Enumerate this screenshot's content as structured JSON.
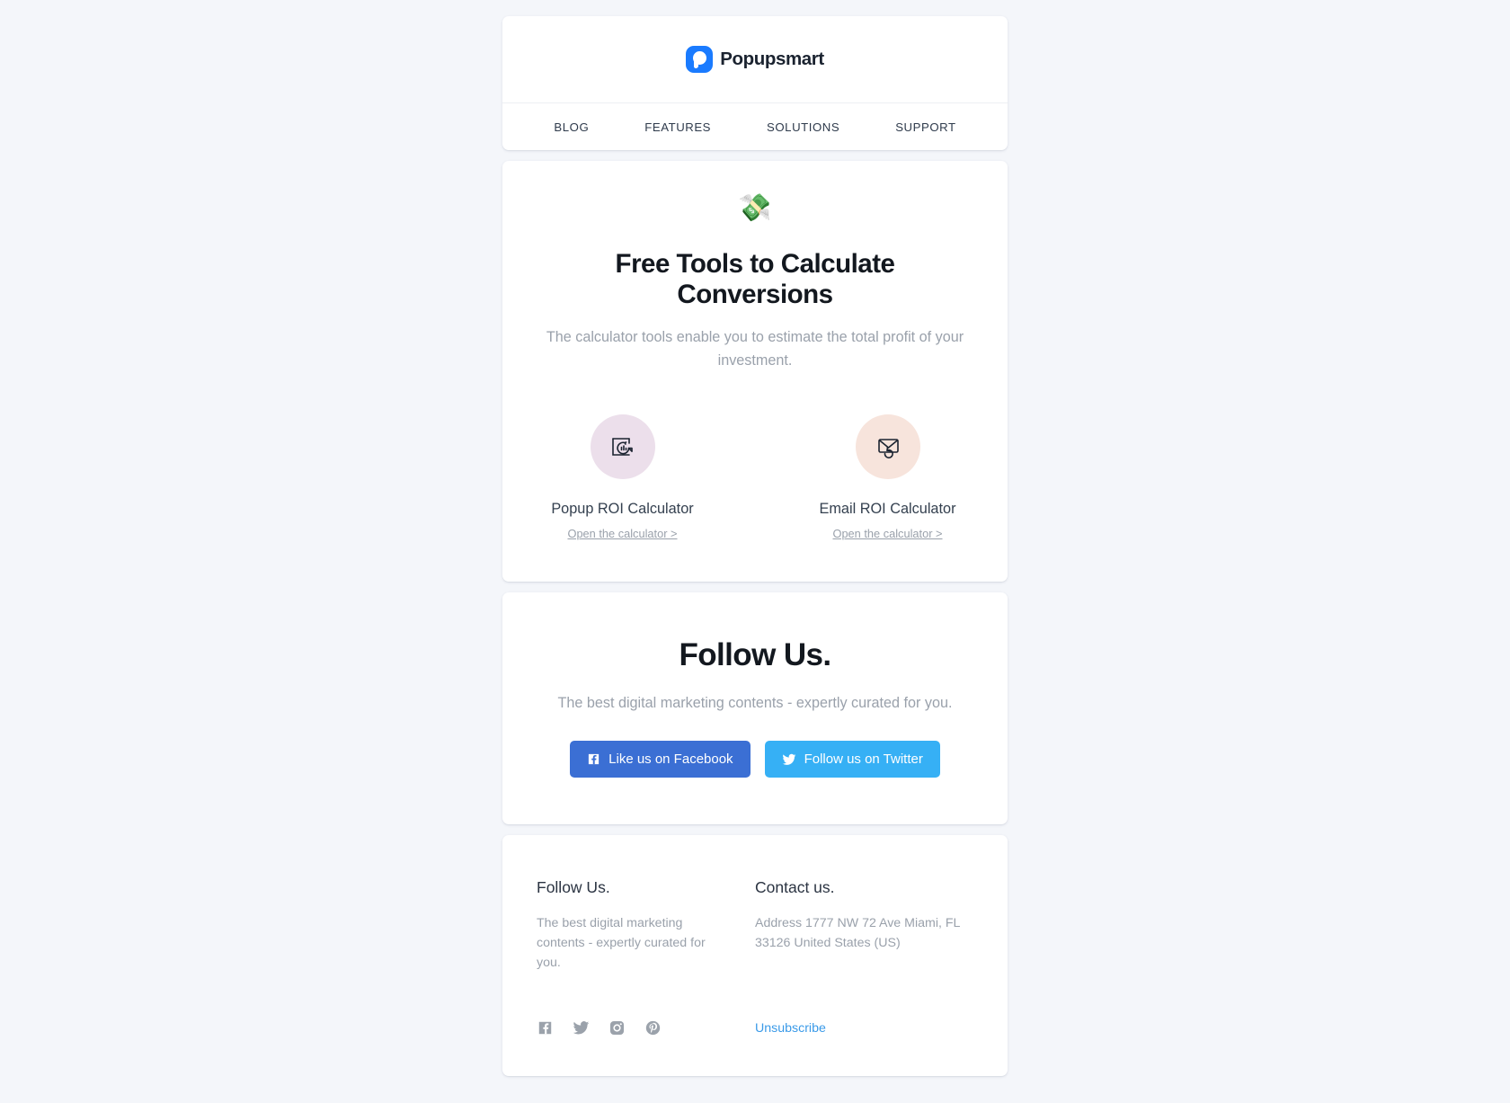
{
  "theme": {
    "page_background": "#f4f6fa",
    "card_background": "#ffffff",
    "brand_blue": "#1a7bff",
    "facebook_blue": "#3b6fd4",
    "twitter_blue": "#36b0f5",
    "link_blue": "#3a9ae8",
    "muted_text": "#9aa1ab",
    "heading_text": "#13181f",
    "popup_icon_bg": "#ecdfeb",
    "email_icon_bg": "#f7e4dc"
  },
  "header": {
    "logo_text": "Popupsmart",
    "logo_icon": "popupsmart-logo-icon",
    "nav": [
      {
        "label": "BLOG"
      },
      {
        "label": "FEATURES"
      },
      {
        "label": "SOLUTIONS"
      },
      {
        "label": "SUPPORT"
      }
    ]
  },
  "hero": {
    "emoji": "💸",
    "emoji_name": "money-with-wings-icon",
    "title": "Free Tools to Calculate Conversions",
    "subtitle": "The calculator tools enable you to estimate the total profit of your investment.",
    "tools": [
      {
        "name": "Popup ROI Calculator",
        "link_label": "Open the calculator >",
        "icon": "popup-roi-icon"
      },
      {
        "name": "Email ROI Calculator",
        "link_label": "Open the calculator >",
        "icon": "email-roi-icon"
      }
    ]
  },
  "follow": {
    "title": "Follow Us.",
    "subtitle": "The best digital marketing contents - expertly curated for you.",
    "buttons": [
      {
        "label": "Like us on Facebook",
        "icon": "facebook-icon"
      },
      {
        "label": "Follow us on Twitter",
        "icon": "twitter-icon"
      }
    ]
  },
  "footer": {
    "left": {
      "heading": "Follow Us.",
      "text": "The best digital marketing contents - expertly curated for you."
    },
    "right": {
      "heading": "Contact us.",
      "text": "Address 1777 NW 72 Ave Miami, FL 33126 United States (US)"
    },
    "social_icons": [
      {
        "name": "facebook-icon"
      },
      {
        "name": "twitter-icon"
      },
      {
        "name": "instagram-icon"
      },
      {
        "name": "pinterest-icon"
      }
    ],
    "unsubscribe_label": "Unsubscribe"
  }
}
